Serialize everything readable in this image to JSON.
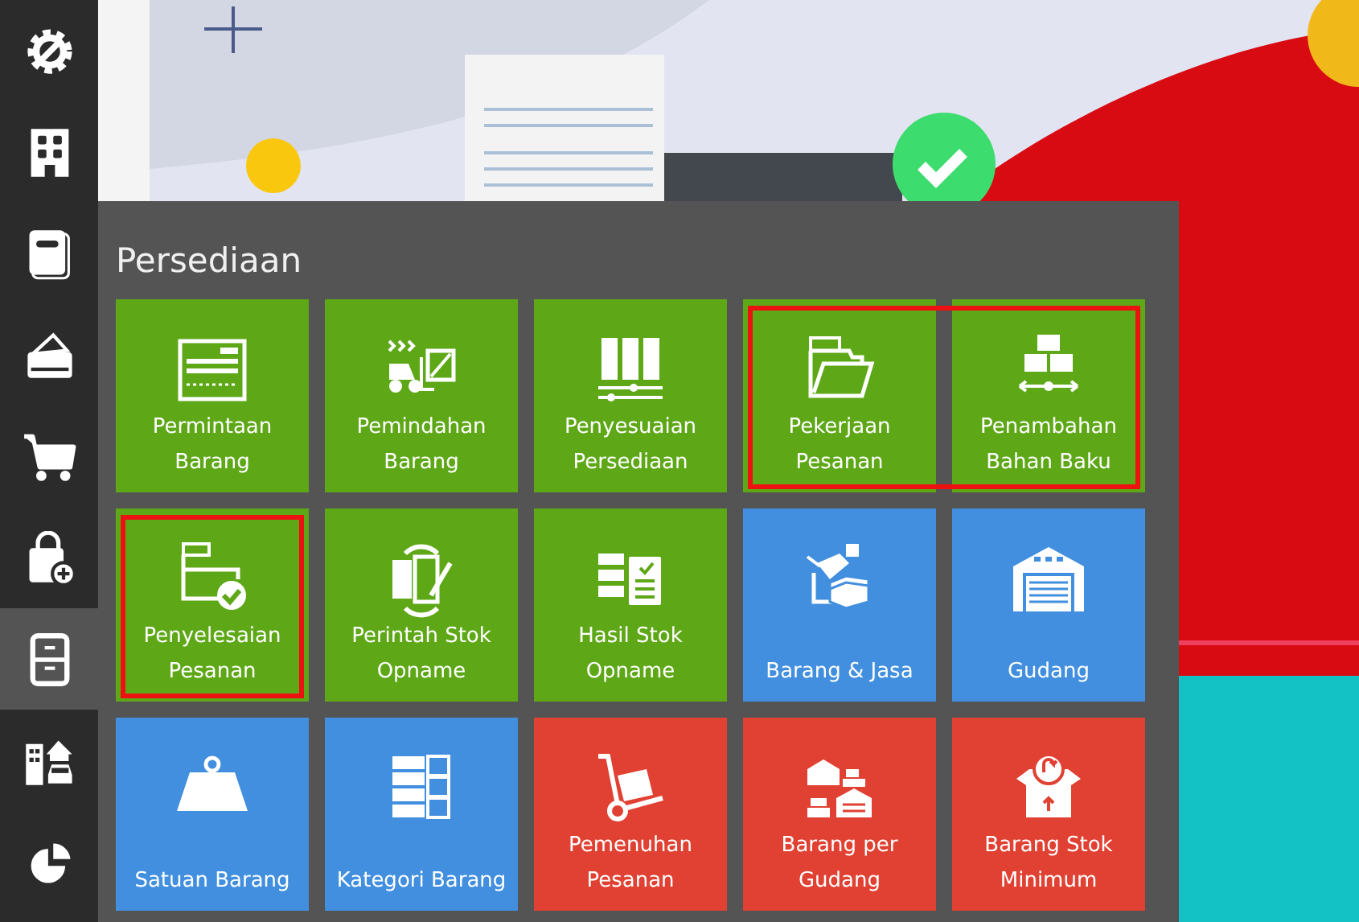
{
  "sidebar": {
    "items": [
      {
        "selected": false
      },
      {
        "selected": false
      },
      {
        "selected": false
      },
      {
        "selected": false
      },
      {
        "selected": false
      },
      {
        "selected": false
      },
      {
        "selected": true
      },
      {
        "selected": false
      },
      {
        "selected": false
      }
    ]
  },
  "panel": {
    "title": "Persediaan",
    "tiles": [
      {
        "label": "Permintaan Barang",
        "color": "#5ea818",
        "marked": false
      },
      {
        "label": "Pemindahan Barang",
        "color": "#5ea818",
        "marked": false
      },
      {
        "label": "Penyesuaian Persediaan",
        "color": "#5ea818",
        "marked": false
      },
      {
        "label": "Pekerjaan Pesanan",
        "color": "#5ea818",
        "marked": true
      },
      {
        "label": "Penambahan Bahan Baku",
        "color": "#5ea818",
        "marked": true
      },
      {
        "label": "Penyelesaian Pesanan",
        "color": "#5ea818",
        "marked": true
      },
      {
        "label": "Perintah Stok Opname",
        "color": "#5ea818",
        "marked": false
      },
      {
        "label": "Hasil Stok Opname",
        "color": "#5ea818",
        "marked": false
      },
      {
        "label": "Barang & Jasa",
        "color": "#418fde",
        "marked": false
      },
      {
        "label": "Gudang",
        "color": "#418fde",
        "marked": false
      },
      {
        "label": "Satuan Barang",
        "color": "#418fde",
        "marked": false
      },
      {
        "label": "Kategori Barang",
        "color": "#418fde",
        "marked": false
      },
      {
        "label": "Pemenuhan Pesanan",
        "color": "#e04133",
        "marked": false
      },
      {
        "label": "Barang per Gudang",
        "color": "#e04133",
        "marked": false
      },
      {
        "label": "Barang Stok Minimum",
        "color": "#e04133",
        "marked": false
      }
    ]
  }
}
